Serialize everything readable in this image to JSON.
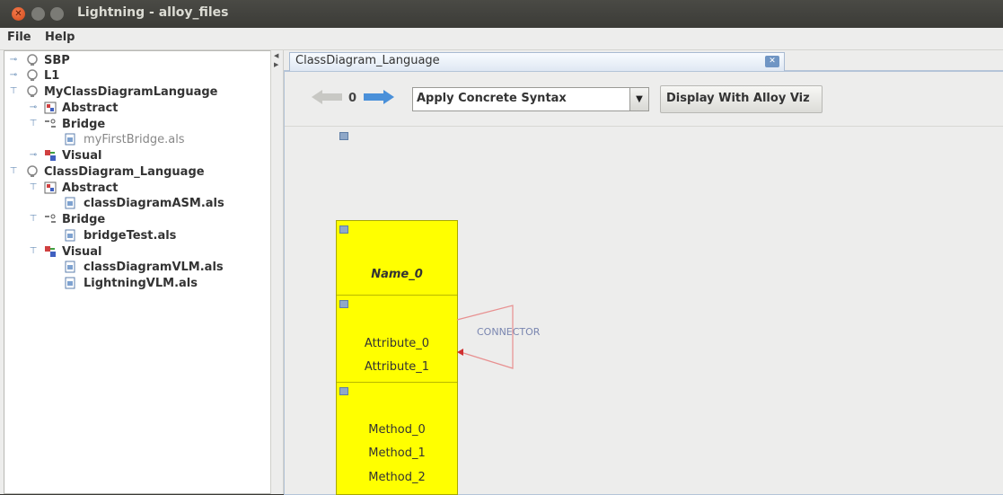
{
  "window": {
    "title": "Lightning - alloy_files"
  },
  "menu": {
    "file": "File",
    "help": "Help"
  },
  "tree": {
    "n0": "SBP",
    "n1": "L1",
    "n2": "MyClassDiagramLanguage",
    "n3": "Abstract",
    "n4": "Bridge",
    "n5": "myFirstBridge.als",
    "n6": "Visual",
    "n7": "ClassDiagram_Language",
    "n8": "Abstract",
    "n9": "classDiagramASM.als",
    "n10": "Bridge",
    "n11": "bridgeTest.als",
    "n12": "Visual",
    "n13": "classDiagramVLM.als",
    "n14": "LightningVLM.als"
  },
  "tab": {
    "label": "ClassDiagram_Language"
  },
  "toolbar": {
    "counter": "0",
    "combo_value": "Apply Concrete Syntax",
    "viz_label": "Display With Alloy Viz"
  },
  "diagram": {
    "name": "Name_0",
    "attr0": "Attribute_0",
    "attr1": "Attribute_1",
    "method0": "Method_0",
    "method1": "Method_1",
    "method2": "Method_2",
    "connector": "CONNECTOR"
  },
  "colors": {
    "class_fill": "#ffff00",
    "connector_line": "#e89090",
    "accent": "#4a90d9"
  },
  "icons": {
    "package": "package-icon",
    "abstract": "abstract-icon",
    "bridge": "bridge-icon",
    "visual": "visual-icon",
    "file": "file-icon"
  }
}
